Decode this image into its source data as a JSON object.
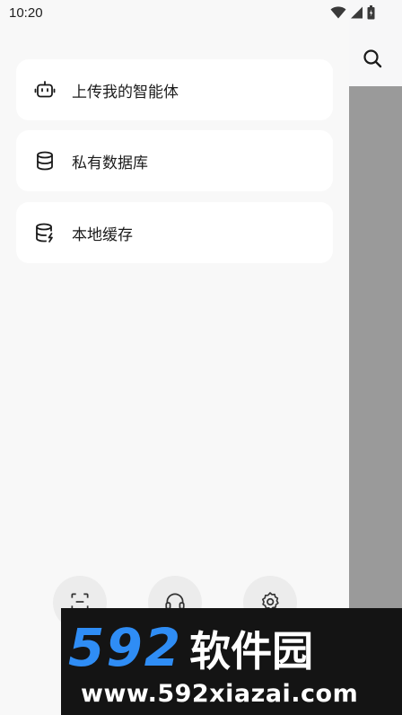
{
  "status_bar": {
    "time": "10:20"
  },
  "menu": {
    "items": [
      {
        "label": "上传我的智能体",
        "icon": "robot-icon"
      },
      {
        "label": "私有数据库",
        "icon": "database-icon"
      },
      {
        "label": "本地缓存",
        "icon": "database-bolt-icon"
      }
    ]
  },
  "bottom_buttons": [
    {
      "icon": "scan-icon"
    },
    {
      "icon": "headset-icon"
    },
    {
      "icon": "gear-icon"
    }
  ],
  "watermark": {
    "number": "592",
    "name": "软件园",
    "url": "www.592xiazai.com"
  }
}
